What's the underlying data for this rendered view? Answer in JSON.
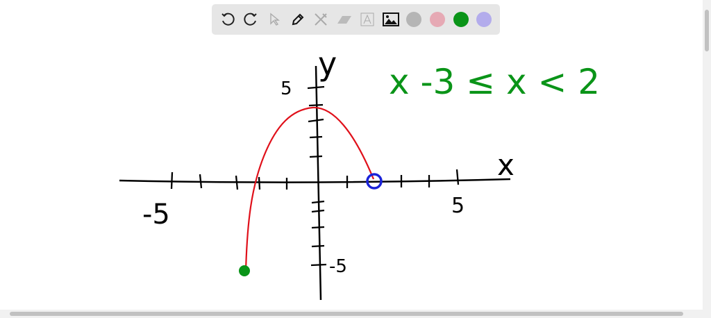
{
  "toolbar": {
    "tools": [
      "undo-icon",
      "redo-icon",
      "select-icon",
      "pen-icon",
      "tools-icon",
      "eraser-icon",
      "text-icon",
      "image-icon"
    ],
    "colors": [
      "#b5b5b5",
      "#e6a9b4",
      "#0a9418",
      "#b3acec"
    ],
    "selected_color": "#0a9418"
  },
  "drawing": {
    "y_axis_label": "y",
    "x_axis_label": "x",
    "y_tick_pos": "5",
    "y_tick_neg": "-5",
    "x_tick_neg": "-5",
    "x_tick_pos": "5",
    "domain_note": "x  -3 ≤ x < 2",
    "curve_color": "#e0101a",
    "closed_point_color": "#0a9418",
    "open_point_color": "#1a22d8",
    "domain_color": "#0a9418"
  }
}
